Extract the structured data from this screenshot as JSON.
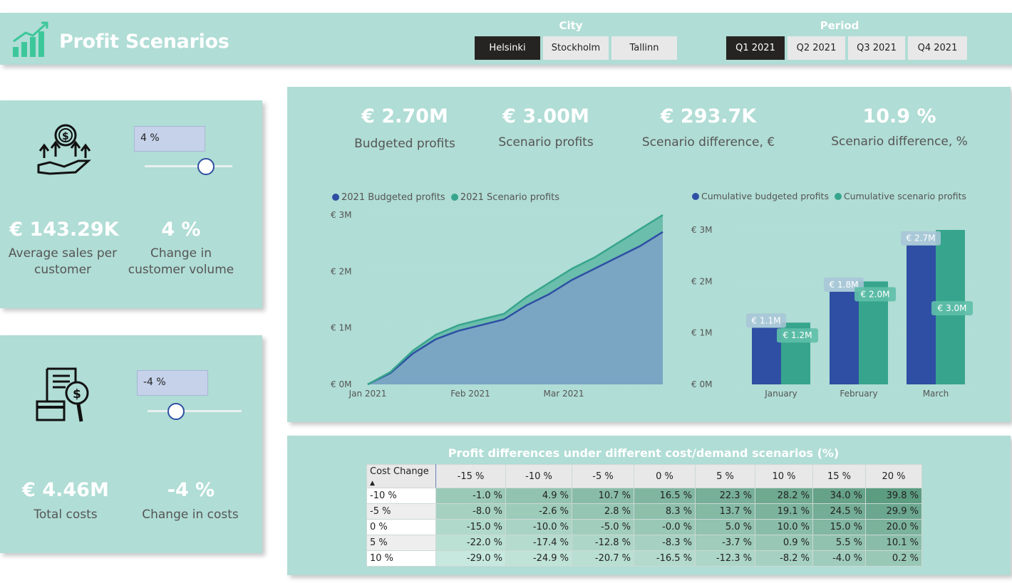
{
  "header": {
    "title": "Profit Scenarios",
    "city_label": "City",
    "cities": [
      "Helsinki",
      "Stockholm",
      "Tallinn"
    ],
    "selected_city": "Helsinki",
    "period_label": "Period",
    "periods": [
      "Q1 2021",
      "Q2 2021",
      "Q3 2021",
      "Q4 2021"
    ],
    "selected_period": "Q1 2021"
  },
  "customer_panel": {
    "input_value": "4 %",
    "slider_value": 4,
    "avg_sales_value": "€ 143.29K",
    "avg_sales_label_1": "Average sales per",
    "avg_sales_label_2": "customer",
    "change_value": "4 %",
    "change_label_1": "Change in",
    "change_label_2": "customer volume"
  },
  "cost_panel": {
    "input_value": "-4 %",
    "slider_value": -4,
    "total_costs_value": "€ 4.46M",
    "total_costs_label": "Total costs",
    "change_value": "-4 %",
    "change_label": "Change in costs"
  },
  "kpis": [
    {
      "value": "€ 2.70M",
      "label": "Budgeted profits"
    },
    {
      "value": "€ 3.00M",
      "label": "Scenario profits"
    },
    {
      "value": "€ 293.7K",
      "label": "Scenario difference, €"
    },
    {
      "value": "10.9 %",
      "label": "Scenario difference, %"
    }
  ],
  "colors": {
    "budgeted": "#2e4fa3",
    "scenario": "#37a58d",
    "panel": "#b0ddd5"
  },
  "chart_data": [
    {
      "type": "area",
      "legend": [
        "2021 Budgeted profits",
        "2021 Scenario profits"
      ],
      "y_ticks": [
        "€ 3M",
        "€ 2M",
        "€ 1M",
        "€ 0M"
      ],
      "x_ticks": [
        "Jan 2021",
        "Feb 2021",
        "Mar 2021"
      ],
      "ylim": [
        0,
        3
      ],
      "x": [
        "Jan 1",
        "Jan 8",
        "Jan 15",
        "Jan 22",
        "Jan 29",
        "Feb 5",
        "Feb 12",
        "Feb 19",
        "Feb 26",
        "Mar 5",
        "Mar 12",
        "Mar 19",
        "Mar 26",
        "Mar 31"
      ],
      "series": [
        {
          "name": "2021 Budgeted profits",
          "values": [
            0.0,
            0.2,
            0.55,
            0.8,
            0.95,
            1.05,
            1.15,
            1.4,
            1.6,
            1.85,
            2.05,
            2.25,
            2.45,
            2.7
          ]
        },
        {
          "name": "2021 Scenario profits",
          "values": [
            0.0,
            0.22,
            0.6,
            0.88,
            1.05,
            1.15,
            1.25,
            1.55,
            1.8,
            2.05,
            2.25,
            2.5,
            2.75,
            3.0
          ]
        }
      ]
    },
    {
      "type": "bar",
      "legend": [
        "Cumulative budgeted profits",
        "Cumulative scenario profits"
      ],
      "categories": [
        "January",
        "February",
        "March"
      ],
      "y_ticks": [
        "€ 3M",
        "€ 2M",
        "€ 1M",
        "€ 0M"
      ],
      "ylim": [
        0,
        3
      ],
      "series": [
        {
          "name": "Cumulative budgeted profits",
          "values": [
            1.1,
            1.8,
            2.7
          ],
          "labels": [
            "€ 1.1M",
            "€ 1.8M",
            "€ 2.7M"
          ]
        },
        {
          "name": "Cumulative scenario profits",
          "values": [
            1.2,
            2.0,
            3.0
          ],
          "labels": [
            "€ 1.2M",
            "€ 2.0M",
            "€ 3.0M"
          ]
        }
      ]
    },
    {
      "type": "table",
      "title": "Profit differences under different cost/demand scenarios (%)",
      "row_header": "Cost Change",
      "columns": [
        "-15 %",
        "-10 %",
        "-5 %",
        "0 %",
        "5 %",
        "10 %",
        "15 %",
        "20 %"
      ],
      "rows": [
        {
          "label": "-10 %",
          "values": [
            "-1.0 %",
            "4.9 %",
            "10.7 %",
            "16.5 %",
            "22.3 %",
            "28.2 %",
            "34.0 %",
            "39.8 %"
          ],
          "nums": [
            -1.0,
            4.9,
            10.7,
            16.5,
            22.3,
            28.2,
            34.0,
            39.8
          ]
        },
        {
          "label": "-5 %",
          "values": [
            "-8.0 %",
            "-2.6 %",
            "2.8 %",
            "8.3 %",
            "13.7 %",
            "19.1 %",
            "24.5 %",
            "29.9 %"
          ],
          "nums": [
            -8.0,
            -2.6,
            2.8,
            8.3,
            13.7,
            19.1,
            24.5,
            29.9
          ]
        },
        {
          "label": "0 %",
          "values": [
            "-15.0 %",
            "-10.0 %",
            "-5.0 %",
            "-0.0 %",
            "5.0 %",
            "10.0 %",
            "15.0 %",
            "20.0 %"
          ],
          "nums": [
            -15.0,
            -10.0,
            -5.0,
            0.0,
            5.0,
            10.0,
            15.0,
            20.0
          ]
        },
        {
          "label": "5 %",
          "values": [
            "-22.0 %",
            "-17.4 %",
            "-12.8 %",
            "-8.3 %",
            "-3.7 %",
            "0.9 %",
            "5.5 %",
            "10.1 %"
          ],
          "nums": [
            -22.0,
            -17.4,
            -12.8,
            -8.3,
            -3.7,
            0.9,
            5.5,
            10.1
          ]
        },
        {
          "label": "10 %",
          "values": [
            "-29.0 %",
            "-24.9 %",
            "-20.7 %",
            "-16.5 %",
            "-12.3 %",
            "-8.2 %",
            "-4.0 %",
            "0.2 %"
          ],
          "nums": [
            -29.0,
            -24.9,
            -20.7,
            -16.5,
            -12.3,
            -8.2,
            -4.0,
            0.2
          ]
        }
      ]
    }
  ]
}
